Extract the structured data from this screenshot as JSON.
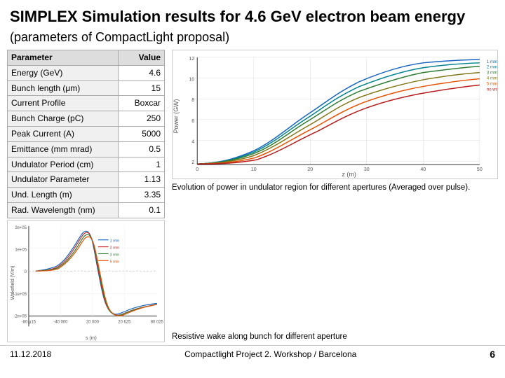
{
  "header": {
    "title": "SIMPLEX Simulation results for 4.6 GeV electron beam energy",
    "subtitle": "(parameters of CompactLight proposal)"
  },
  "table": {
    "rows": [
      {
        "param": "Parameter",
        "value": "Value",
        "header": true
      },
      {
        "param": "Energy (GeV)",
        "value": "4.6"
      },
      {
        "param": "Bunch length (μm)",
        "value": "15"
      },
      {
        "param": "Current Profile",
        "value": "Boxcar"
      },
      {
        "param": "Bunch Charge (pC)",
        "value": "250"
      },
      {
        "param": "Peak Current (A)",
        "value": "5000"
      },
      {
        "param": "Emittance (mm mrad)",
        "value": "0.5"
      },
      {
        "param": "Undulator Period (cm)",
        "value": "1"
      },
      {
        "param": "Undulator Parameter",
        "value": "1.13"
      },
      {
        "param": "Und. Length (m)",
        "value": "3.35"
      },
      {
        "param": "Rad. Wavelength (nm)",
        "value": "0.1"
      }
    ]
  },
  "chart_top_caption": "Evolution of power in undulator region for different apertures (Averaged over pulse).",
  "chart_bottom_caption": "Resistive wake along bunch for different aperture",
  "footer": {
    "date": "11.12.2018",
    "center": "Compactlight Project 2. Workshop / Barcelona",
    "page": "6"
  }
}
